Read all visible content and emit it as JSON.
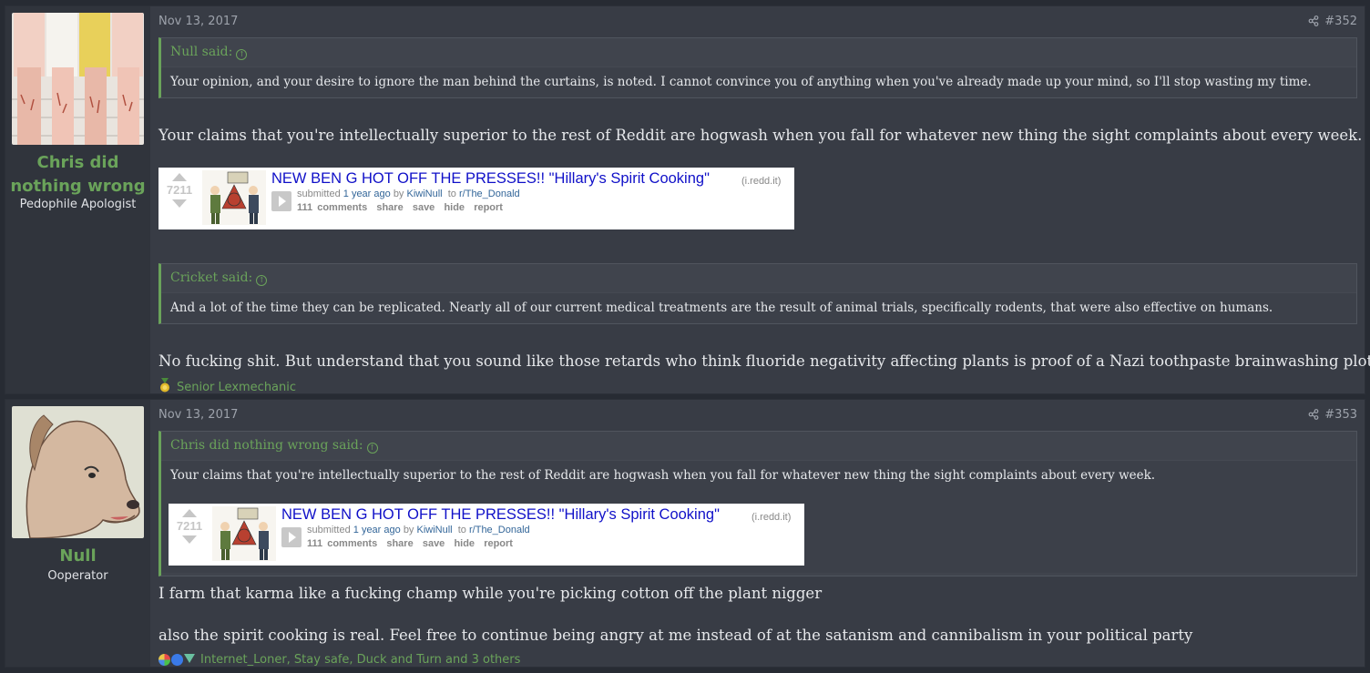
{
  "posts": [
    {
      "username": "Chris did nothing wrong",
      "user_title": "Pedophile Apologist",
      "date": "Nov 13, 2017",
      "post_number": "#352",
      "quotes": [
        {
          "author_label": "Null said:",
          "text": "Your opinion, and your desire to ignore the man behind the curtains, is noted. I cannot convince you of anything when you've already made up your mind, so I'll stop wasting my time."
        },
        {
          "author_label": "Cricket said:",
          "text": "And a lot of the time they can be replicated. Nearly all of our current medical treatments are the result of animal trials, specifically rodents, that were also effective on humans."
        }
      ],
      "body": [
        "Your claims that you're intellectually superior to the rest of Reddit are hogwash when you fall for whatever new thing the sight complaints about every week.",
        "No fucking shit. But understand that you sound like those retards who think fluoride negativity affecting plants is proof of a Nazi toothpaste brainwashing plot."
      ],
      "embed": {
        "score": "7211",
        "title": "NEW BEN G HOT OFF THE PRESSES!! \"Hillary's Spirit Cooking\"",
        "domain": "(i.redd.it)",
        "submitted": "submitted",
        "age": "1 year ago",
        "by": "by",
        "author": "KiwiNull",
        "to": "to",
        "subreddit": "r/The_Donald",
        "actions": [
          "111 comments",
          "share",
          "save",
          "hide",
          "report"
        ]
      },
      "reactions": "Senior Lexmechanic"
    },
    {
      "username": "Null",
      "user_title": "Ooperator",
      "date": "Nov 13, 2017",
      "post_number": "#353",
      "quotes": [
        {
          "author_label": "Chris did nothing wrong said:",
          "text": "Your claims that you're intellectually superior to the rest of Reddit are hogwash when you fall for whatever new thing the sight complaints about every week."
        }
      ],
      "body": [
        "I farm that karma like a fucking champ while you're picking cotton off the plant nigger",
        "also the spirit cooking is real. Feel free to continue being angry at me instead of at the satanism and cannibalism in your political party"
      ],
      "embed": {
        "score": "7211",
        "title": "NEW BEN G HOT OFF THE PRESSES!! \"Hillary's Spirit Cooking\"",
        "domain": "(i.redd.it)",
        "submitted": "submitted",
        "age": "1 year ago",
        "by": "by",
        "author": "KiwiNull",
        "to": "to",
        "subreddit": "r/The_Donald",
        "actions": [
          "111 comments",
          "share",
          "save",
          "hide",
          "report"
        ]
      },
      "reactions": "Internet_Loner, Stay safe, Duck and Turn and 3 others"
    }
  ],
  "icons": {
    "share": "share-icon",
    "quote_jump": "arrow-up-circle-icon",
    "upvote": "upvote-arrow-icon",
    "downvote": "downvote-arrow-icon",
    "play": "play-icon"
  },
  "colors": {
    "accent": "#6aa35a",
    "background": "#383c45",
    "sidebar": "#30343c",
    "link_blue": "#1010c8"
  }
}
